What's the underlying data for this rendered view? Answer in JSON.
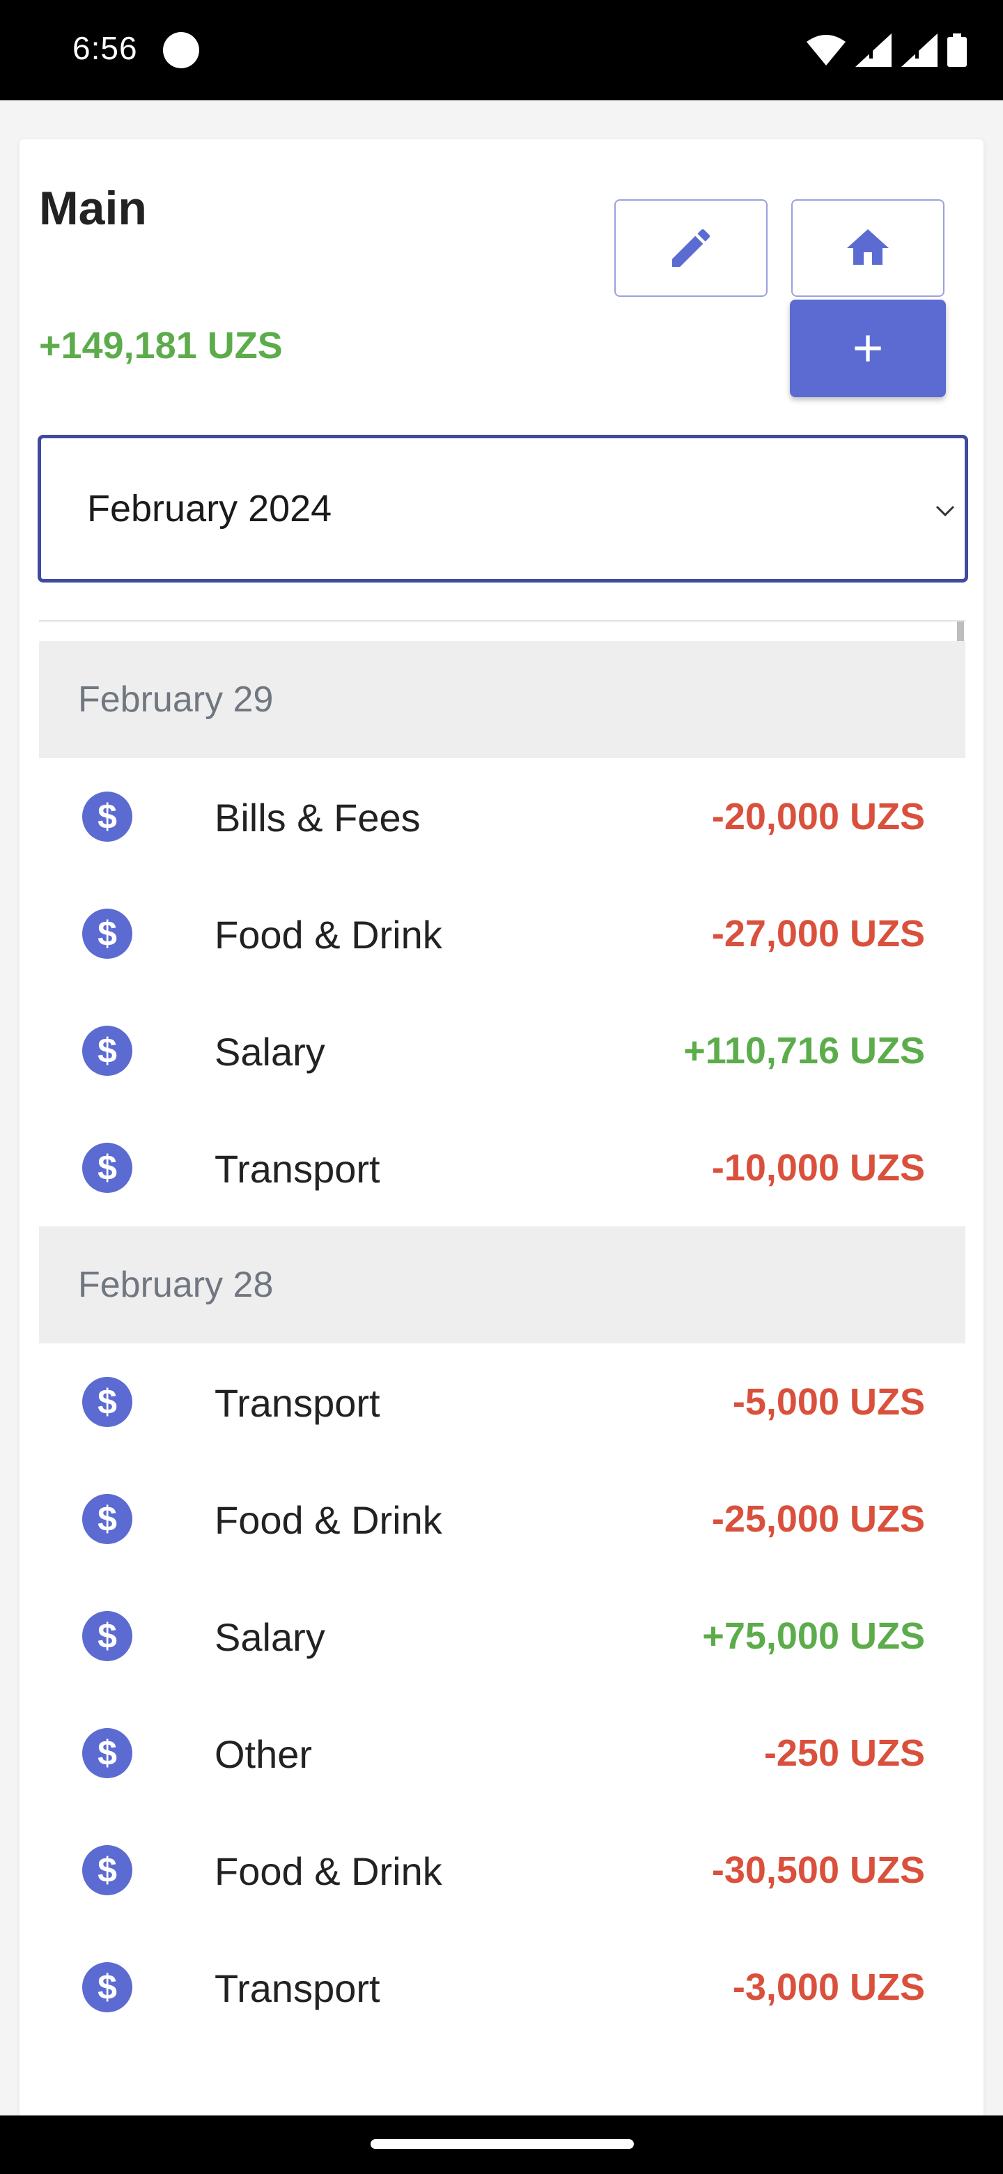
{
  "status_bar": {
    "time": "6:56"
  },
  "header": {
    "title": "Main",
    "total": "+149,181 UZS"
  },
  "icons": {
    "edit": "pencil-icon",
    "home": "home-icon",
    "add": "plus-icon",
    "row": "dollar-circle-icon"
  },
  "colors": {
    "accent": "#5b6bd1",
    "positive": "#5cac4c",
    "negative": "#d9503c",
    "header_bg": "#eeeeee"
  },
  "month_selector": {
    "value": "February 2024"
  },
  "groups": [
    {
      "date": "February 29",
      "items": [
        {
          "category": "Bills & Fees",
          "amount": "-20,000 UZS",
          "type": "neg"
        },
        {
          "category": "Food & Drink",
          "amount": "-27,000 UZS",
          "type": "neg"
        },
        {
          "category": "Salary",
          "amount": "+110,716 UZS",
          "type": "pos"
        },
        {
          "category": "Transport",
          "amount": "-10,000 UZS",
          "type": "neg"
        }
      ]
    },
    {
      "date": "February 28",
      "items": [
        {
          "category": "Transport",
          "amount": "-5,000 UZS",
          "type": "neg"
        },
        {
          "category": "Food & Drink",
          "amount": "-25,000 UZS",
          "type": "neg"
        },
        {
          "category": "Salary",
          "amount": "+75,000 UZS",
          "type": "pos"
        },
        {
          "category": "Other",
          "amount": "-250 UZS",
          "type": "neg"
        },
        {
          "category": "Food & Drink",
          "amount": "-30,500 UZS",
          "type": "neg"
        },
        {
          "category": "Transport",
          "amount": "-3,000 UZS",
          "type": "neg"
        }
      ]
    }
  ]
}
